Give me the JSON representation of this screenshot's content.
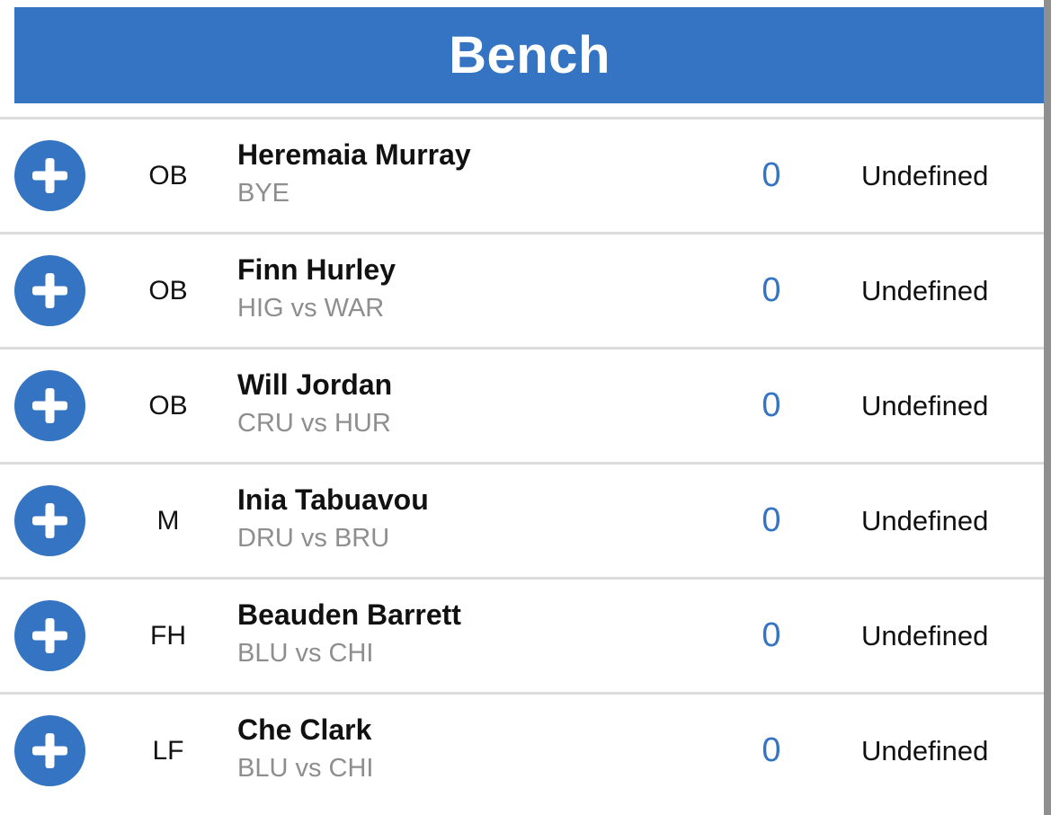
{
  "header": {
    "title": "Bench"
  },
  "colors": {
    "accent": "#3474c2",
    "divider": "#dcdcdc",
    "fixture_text": "#8e8e8e"
  },
  "players": [
    {
      "position": "OB",
      "name": "Heremaia Murray",
      "fixture": "BYE",
      "points": "0",
      "status": "Undefined",
      "icon": "plus-circle-icon"
    },
    {
      "position": "OB",
      "name": "Finn Hurley",
      "fixture": "HIG vs WAR",
      "points": "0",
      "status": "Undefined",
      "icon": "plus-circle-icon"
    },
    {
      "position": "OB",
      "name": "Will Jordan",
      "fixture": "CRU vs HUR",
      "points": "0",
      "status": "Undefined",
      "icon": "plus-circle-icon"
    },
    {
      "position": "M",
      "name": "Inia Tabuavou",
      "fixture": "DRU vs BRU",
      "points": "0",
      "status": "Undefined",
      "icon": "plus-circle-icon"
    },
    {
      "position": "FH",
      "name": "Beauden Barrett",
      "fixture": "BLU vs CHI",
      "points": "0",
      "status": "Undefined",
      "icon": "plus-circle-icon"
    },
    {
      "position": "LF",
      "name": "Che Clark",
      "fixture": "BLU vs CHI",
      "points": "0",
      "status": "Undefined",
      "icon": "plus-circle-icon"
    }
  ]
}
